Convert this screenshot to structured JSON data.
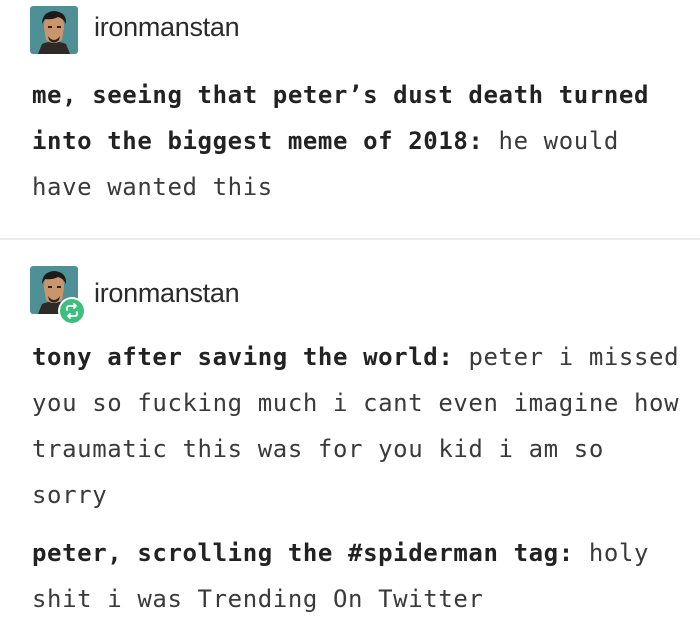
{
  "posts": [
    {
      "username": "ironmanstan",
      "avatar_icon": "character-portrait-icon",
      "body": {
        "bold": "me, seeing that peter’s dust death turned into the biggest meme of 2018:",
        "normal": " he would have wanted this"
      }
    },
    {
      "username": "ironmanstan",
      "avatar_icon": "character-portrait-icon",
      "badge_icon": "reblog-icon",
      "paragraphs": [
        {
          "bold": "tony after saving the world:",
          "normal": " peter i missed you so fucking much i cant even imagine how traumatic this was for you kid i am so sorry"
        },
        {
          "bold": "peter, scrolling the #spiderman tag:",
          "normal": " holy shit i was Trending On Twitter"
        }
      ]
    }
  ],
  "colors": {
    "reblog_badge": "#3fbf7f",
    "divider": "#ebebeb"
  }
}
